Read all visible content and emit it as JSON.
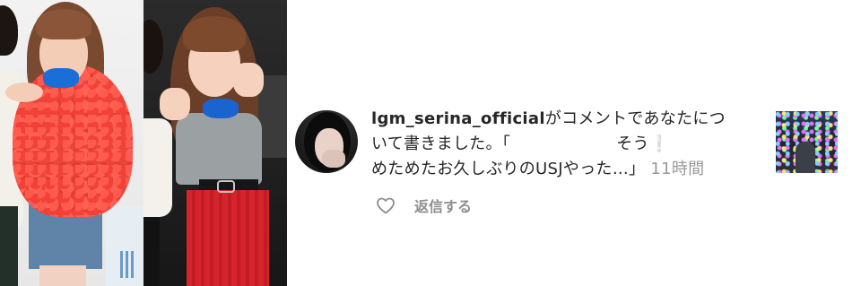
{
  "notification": {
    "username": "lgm_serina_official",
    "message_line1": "がコメントであなたにつ",
    "message_line2_start": "いて書きました。「",
    "message_line2_end": "そう",
    "message_line3": "めためたお久しぶりのUSJやった…」",
    "emoji": "❕",
    "timestamp": "11時間"
  },
  "actions": {
    "like_icon": "heart-outline-icon",
    "reply_label": "返信する"
  },
  "colors": {
    "text": "#262626",
    "secondary": "#999999",
    "action": "#8e8e8e"
  }
}
